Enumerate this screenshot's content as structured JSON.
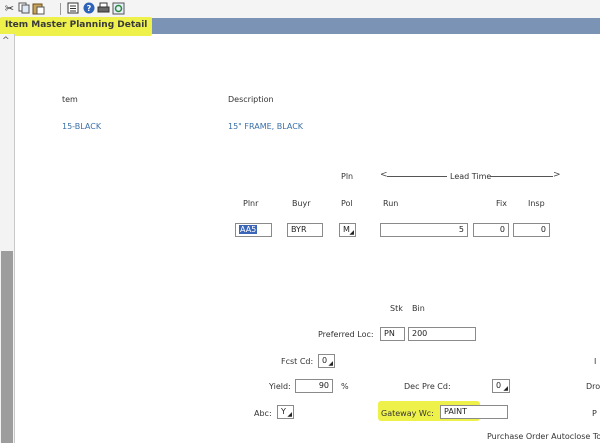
{
  "toolbar": {
    "icons": [
      "scissors-icon",
      "copy-icon",
      "paste-icon",
      "form-icon",
      "help-icon",
      "print-icon",
      "refresh-icon"
    ]
  },
  "window": {
    "title": "Item Master Planning Detail",
    "highlight_color": "#eef14a"
  },
  "header": {
    "item_label": "tem",
    "item_value": "15-BLACK",
    "description_label": "Description",
    "description_value": "15\" FRAME, BLACK"
  },
  "planning": {
    "pln_label": "Pln",
    "pol_sub_label": "Pol",
    "lead_time_label": "Lead Time",
    "plnr_label": "Plnr",
    "plnr_value": "AA5",
    "buyr_label": "Buyr",
    "buyr_value": "BYR",
    "pol_value": "M",
    "run_label": "Run",
    "run_value": "5",
    "fix_label": "Fix",
    "fix_value": "0",
    "insp_label": "Insp",
    "insp_value": "0"
  },
  "location": {
    "stk_label": "Stk",
    "bin_label": "Bin",
    "preferred_loc_label": "Preferred Loc:",
    "stk_value": "PN",
    "bin_value": "200"
  },
  "details": {
    "fcst_cd_label": "Fcst Cd:",
    "fcst_cd_value": "0",
    "yield_label": "Yield:",
    "yield_value": "90",
    "yield_unit": "%",
    "dec_pre_cd_label": "Dec Pre Cd:",
    "dec_pre_cd_value": "0",
    "abc_label": "Abc:",
    "abc_value": "Y",
    "gateway_wc_label": "Gateway Wc:",
    "gateway_wc_value": "PAINT",
    "po_autoclose_label": "Purchase Order Autoclose To",
    "edge_label_1": "I",
    "edge_label_2": "Dro",
    "edge_label_3": "P"
  }
}
